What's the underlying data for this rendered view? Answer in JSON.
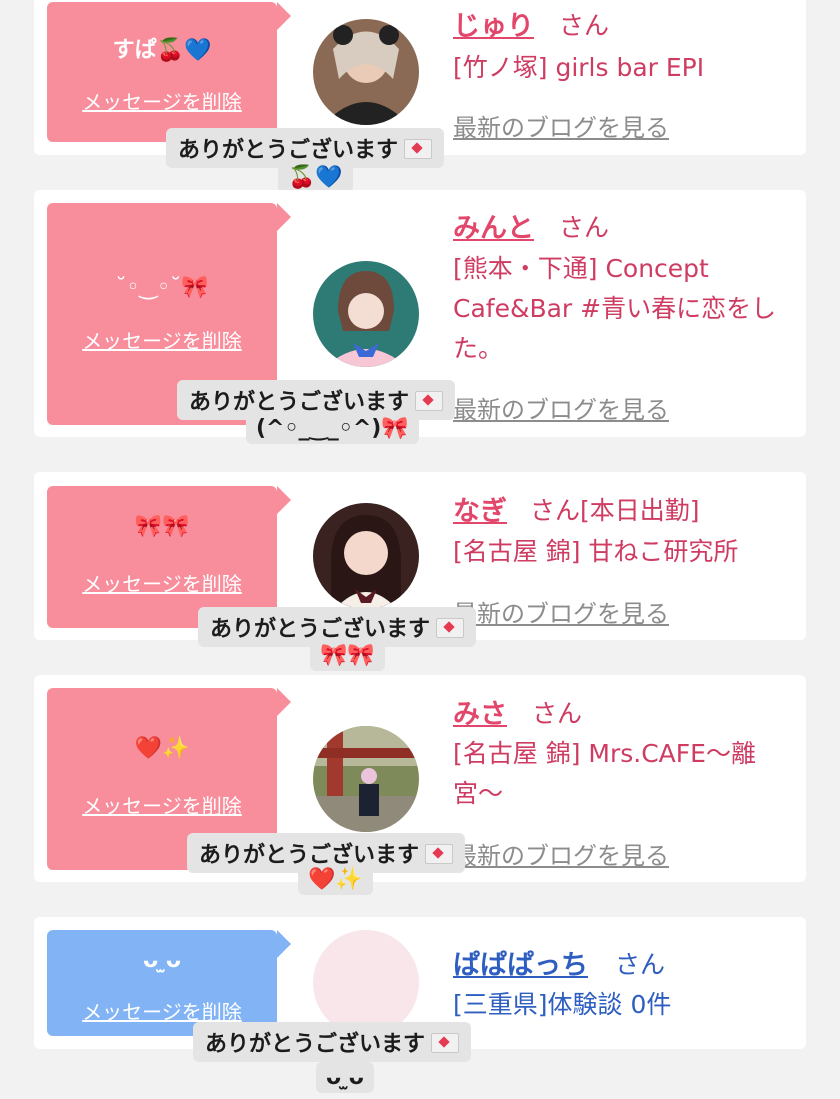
{
  "entries": [
    {
      "message": "すぱ🍒💙",
      "delete_label": "メッセージを削除",
      "name": "じゅり",
      "san": "さん",
      "shop": "[竹ノ塚] girls bar EPI",
      "blog_link": "最新のブログを見る",
      "tooltip": "ありがとうございます",
      "tooltip_sub": "🍒💙"
    },
    {
      "message": "˘◦‿◦˘🎀",
      "delete_label": "メッセージを削除",
      "name": "みんと",
      "san": "さん",
      "shop": "[熊本・下通] Concept Cafe&Bar #青い春に恋をした。",
      "blog_link": "最新のブログを見る",
      "tooltip": "ありがとうございます",
      "tooltip_sub": "(^◦_‿_◦^)🎀"
    },
    {
      "message": "🎀🎀",
      "delete_label": "メッセージを削除",
      "name": "なぎ",
      "san": "さん[本日出勤]",
      "shop": "[名古屋 錦] 甘ねこ研究所",
      "blog_link": "最新のブログを見る",
      "tooltip": "ありがとうございます",
      "tooltip_sub": "🎀🎀"
    },
    {
      "message": "❤️✨",
      "delete_label": "メッセージを削除",
      "name": "みさ",
      "san": "さん",
      "shop": "[名古屋 錦] Mrs.CAFE〜離宮〜",
      "blog_link": "最新のブログを見る",
      "tooltip": "ありがとうございます",
      "tooltip_sub": "❤️✨"
    },
    {
      "message": "ᴗ ̫ᴗ",
      "delete_label": "メッセージを削除",
      "name": "ぱぱぱっち",
      "san": "さん",
      "shop": "[三重県]体験談 0件",
      "tooltip": "ありがとうございます",
      "tooltip_sub": "ᴗ ̫ᴗ"
    }
  ],
  "icons": {
    "envelope": "love-letter-icon"
  },
  "colors": {
    "pink_bubble": "#f88d9c",
    "blue_bubble": "#82b4f5",
    "name_pink": "#e2466a",
    "name_blue": "#2d5ec0",
    "blog_gray": "#8c8c8c",
    "page_bg": "#f2f2f2"
  }
}
